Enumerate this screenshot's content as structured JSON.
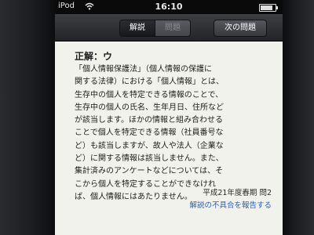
{
  "statusbar": {
    "carrier": "iPod",
    "time": "16:10",
    "battery_level": 0.85
  },
  "toolbar": {
    "tab_explanation": "解説",
    "tab_question": "問題",
    "next_button": "次の問題"
  },
  "answer": {
    "label": "正解：ウ"
  },
  "explanation": {
    "lines": [
      "「個人情報保護法」（個人情報の保護に",
      "関する法律）における「個人情報」とは、",
      "生存中の個人を特定できる情報のことで、",
      "生存中の個人の氏名、生年月日、住所など",
      "が該当します。ほかの情報と組み合わせる",
      "ことで個人を特定できる情報（社員番号な",
      "ど）も該当しますが、故人や法人（企業な",
      "ど）に関する情報は該当しません。また、",
      "集計済みのアンケートなどについては、そ",
      "こから個人を特定することができなけれ",
      "ば、個人情報にはあたりません。"
    ]
  },
  "source": {
    "text": "平成21年度春期 問2"
  },
  "report_link": {
    "text": "解説の不具合を報告する"
  }
}
